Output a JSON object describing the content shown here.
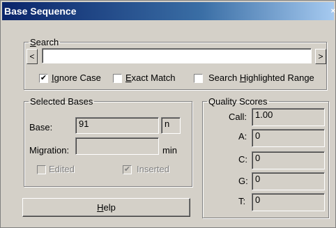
{
  "window": {
    "title": "Base Sequence",
    "close_glyph": "×"
  },
  "search": {
    "legend_prefix": "",
    "legend_accel": "S",
    "legend_rest": "earch",
    "value": "",
    "left_arrow": "<",
    "right_arrow": ">",
    "ignore_case": {
      "checked": true,
      "mark": "✔",
      "accel": "I",
      "rest": "gnore Case"
    },
    "exact_match": {
      "checked": false,
      "mark": "",
      "accel": "E",
      "rest": "xact Match"
    },
    "highlighted": {
      "checked": false,
      "mark": "",
      "prefix": "Search ",
      "accel": "H",
      "rest": "ighlighted Range"
    }
  },
  "selected_bases": {
    "legend": "Selected Bases",
    "base_label": "Base:",
    "base_value": "91",
    "base_code": "n",
    "migration_label": "Migration:",
    "migration_value": "",
    "migration_unit": "min",
    "edited": {
      "checked": false,
      "mark": "",
      "label": "Edited"
    },
    "inserted": {
      "checked": true,
      "mark": "✔",
      "label": "Inserted"
    }
  },
  "quality_scores": {
    "legend": "Quality Scores",
    "call_label": "Call:",
    "call_value": "1.00",
    "a_label": "A:",
    "a_value": "0",
    "c_label": "C:",
    "c_value": "0",
    "g_label": "G:",
    "g_value": "0",
    "t_label": "T:",
    "t_value": "0"
  },
  "help_button": {
    "accel": "H",
    "rest": "elp"
  }
}
